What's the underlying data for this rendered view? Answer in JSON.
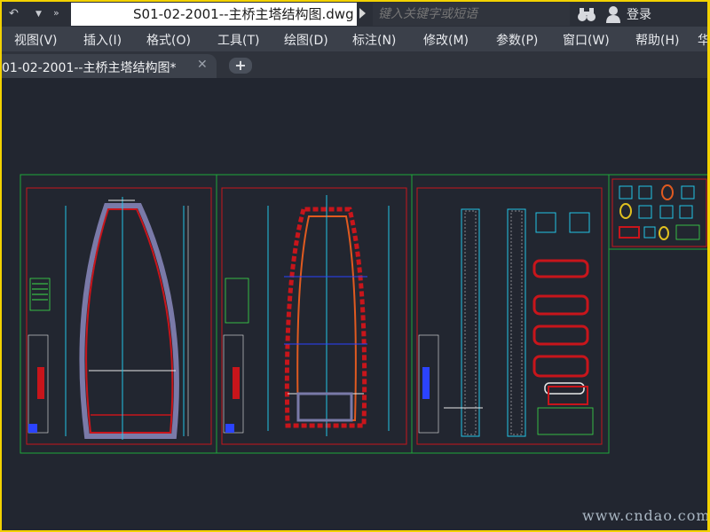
{
  "titlebar": {
    "document_title": "S01-02-2001--主桥主塔结构图.dwg",
    "search_placeholder": "键入关键字或短语",
    "login_label": "登录"
  },
  "menu": {
    "items": [
      "视图(V)",
      "插入(I)",
      "格式(O)",
      "工具(T)",
      "绘图(D)",
      "标注(N)",
      "修改(M)",
      "参数(P)",
      "窗口(W)",
      "帮助(H)",
      "华"
    ]
  },
  "tabs": {
    "active_label": "01-02-2001--主桥主塔结构图*",
    "close_glyph": "✕",
    "add_glyph": "+"
  },
  "watermark": "www.cndao.com",
  "colors": {
    "canvas_bg": "#222630",
    "sheet_border": "#1fa83a",
    "frame_red": "#c8151b",
    "line_cyan": "#23c4e6",
    "line_blue": "#2b43ff",
    "line_white": "#e8e8e8",
    "text_green": "#3ee04a",
    "highlight_orange": "#e05a20",
    "outer_border": "#f3d200"
  }
}
